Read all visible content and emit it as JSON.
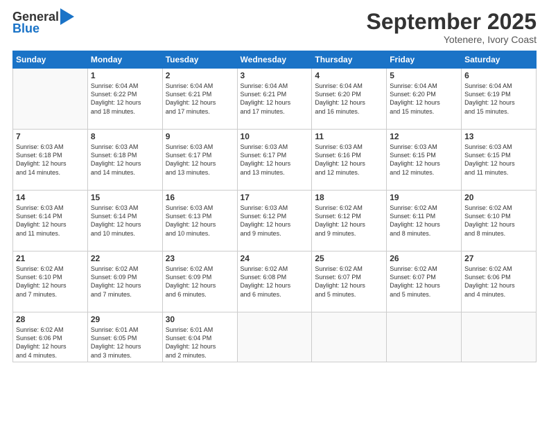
{
  "logo": {
    "line1": "General",
    "line2": "Blue"
  },
  "header": {
    "month": "September 2025",
    "location": "Yotenere, Ivory Coast"
  },
  "days_of_week": [
    "Sunday",
    "Monday",
    "Tuesday",
    "Wednesday",
    "Thursday",
    "Friday",
    "Saturday"
  ],
  "weeks": [
    [
      {
        "day": "",
        "info": ""
      },
      {
        "day": "1",
        "info": "Sunrise: 6:04 AM\nSunset: 6:22 PM\nDaylight: 12 hours\nand 18 minutes."
      },
      {
        "day": "2",
        "info": "Sunrise: 6:04 AM\nSunset: 6:21 PM\nDaylight: 12 hours\nand 17 minutes."
      },
      {
        "day": "3",
        "info": "Sunrise: 6:04 AM\nSunset: 6:21 PM\nDaylight: 12 hours\nand 17 minutes."
      },
      {
        "day": "4",
        "info": "Sunrise: 6:04 AM\nSunset: 6:20 PM\nDaylight: 12 hours\nand 16 minutes."
      },
      {
        "day": "5",
        "info": "Sunrise: 6:04 AM\nSunset: 6:20 PM\nDaylight: 12 hours\nand 15 minutes."
      },
      {
        "day": "6",
        "info": "Sunrise: 6:04 AM\nSunset: 6:19 PM\nDaylight: 12 hours\nand 15 minutes."
      }
    ],
    [
      {
        "day": "7",
        "info": "Sunrise: 6:03 AM\nSunset: 6:18 PM\nDaylight: 12 hours\nand 14 minutes."
      },
      {
        "day": "8",
        "info": "Sunrise: 6:03 AM\nSunset: 6:18 PM\nDaylight: 12 hours\nand 14 minutes."
      },
      {
        "day": "9",
        "info": "Sunrise: 6:03 AM\nSunset: 6:17 PM\nDaylight: 12 hours\nand 13 minutes."
      },
      {
        "day": "10",
        "info": "Sunrise: 6:03 AM\nSunset: 6:17 PM\nDaylight: 12 hours\nand 13 minutes."
      },
      {
        "day": "11",
        "info": "Sunrise: 6:03 AM\nSunset: 6:16 PM\nDaylight: 12 hours\nand 12 minutes."
      },
      {
        "day": "12",
        "info": "Sunrise: 6:03 AM\nSunset: 6:15 PM\nDaylight: 12 hours\nand 12 minutes."
      },
      {
        "day": "13",
        "info": "Sunrise: 6:03 AM\nSunset: 6:15 PM\nDaylight: 12 hours\nand 11 minutes."
      }
    ],
    [
      {
        "day": "14",
        "info": "Sunrise: 6:03 AM\nSunset: 6:14 PM\nDaylight: 12 hours\nand 11 minutes."
      },
      {
        "day": "15",
        "info": "Sunrise: 6:03 AM\nSunset: 6:14 PM\nDaylight: 12 hours\nand 10 minutes."
      },
      {
        "day": "16",
        "info": "Sunrise: 6:03 AM\nSunset: 6:13 PM\nDaylight: 12 hours\nand 10 minutes."
      },
      {
        "day": "17",
        "info": "Sunrise: 6:03 AM\nSunset: 6:12 PM\nDaylight: 12 hours\nand 9 minutes."
      },
      {
        "day": "18",
        "info": "Sunrise: 6:02 AM\nSunset: 6:12 PM\nDaylight: 12 hours\nand 9 minutes."
      },
      {
        "day": "19",
        "info": "Sunrise: 6:02 AM\nSunset: 6:11 PM\nDaylight: 12 hours\nand 8 minutes."
      },
      {
        "day": "20",
        "info": "Sunrise: 6:02 AM\nSunset: 6:10 PM\nDaylight: 12 hours\nand 8 minutes."
      }
    ],
    [
      {
        "day": "21",
        "info": "Sunrise: 6:02 AM\nSunset: 6:10 PM\nDaylight: 12 hours\nand 7 minutes."
      },
      {
        "day": "22",
        "info": "Sunrise: 6:02 AM\nSunset: 6:09 PM\nDaylight: 12 hours\nand 7 minutes."
      },
      {
        "day": "23",
        "info": "Sunrise: 6:02 AM\nSunset: 6:09 PM\nDaylight: 12 hours\nand 6 minutes."
      },
      {
        "day": "24",
        "info": "Sunrise: 6:02 AM\nSunset: 6:08 PM\nDaylight: 12 hours\nand 6 minutes."
      },
      {
        "day": "25",
        "info": "Sunrise: 6:02 AM\nSunset: 6:07 PM\nDaylight: 12 hours\nand 5 minutes."
      },
      {
        "day": "26",
        "info": "Sunrise: 6:02 AM\nSunset: 6:07 PM\nDaylight: 12 hours\nand 5 minutes."
      },
      {
        "day": "27",
        "info": "Sunrise: 6:02 AM\nSunset: 6:06 PM\nDaylight: 12 hours\nand 4 minutes."
      }
    ],
    [
      {
        "day": "28",
        "info": "Sunrise: 6:02 AM\nSunset: 6:06 PM\nDaylight: 12 hours\nand 4 minutes."
      },
      {
        "day": "29",
        "info": "Sunrise: 6:01 AM\nSunset: 6:05 PM\nDaylight: 12 hours\nand 3 minutes."
      },
      {
        "day": "30",
        "info": "Sunrise: 6:01 AM\nSunset: 6:04 PM\nDaylight: 12 hours\nand 2 minutes."
      },
      {
        "day": "",
        "info": ""
      },
      {
        "day": "",
        "info": ""
      },
      {
        "day": "",
        "info": ""
      },
      {
        "day": "",
        "info": ""
      }
    ]
  ]
}
